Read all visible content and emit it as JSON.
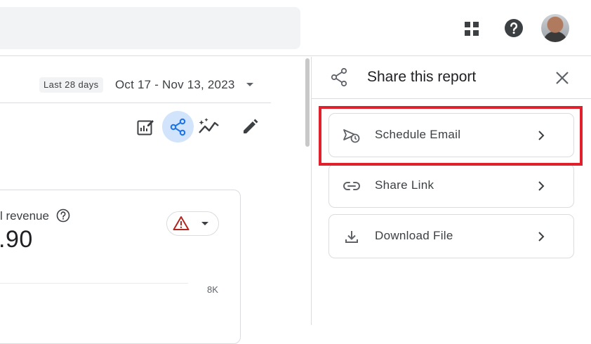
{
  "topbar": {
    "apps_icon": "apps-grid-icon",
    "help_icon": "help-icon",
    "avatar": "account-avatar"
  },
  "report": {
    "date_chip": "Last 28 days",
    "date_range": "Oct 17 - Nov 13, 2023",
    "toolbar_icons": [
      "edit-report-icon",
      "share-icon",
      "insights-icon",
      "pencil-icon"
    ],
    "metric_label": "l revenue",
    "metric_value": ".90",
    "axis_label": "8K",
    "warning_icon": "warning-icon"
  },
  "share_panel": {
    "title": "Share this report",
    "options": [
      {
        "label": "Schedule Email",
        "icon": "schedule-email-icon"
      },
      {
        "label": "Share Link",
        "icon": "link-icon"
      },
      {
        "label": "Download File",
        "icon": "download-icon"
      }
    ]
  },
  "colors": {
    "accent": "#1a73e8",
    "highlight_border": "#e0202a",
    "share_active_bg": "#d2e3fc",
    "warning": "#b3261e"
  }
}
